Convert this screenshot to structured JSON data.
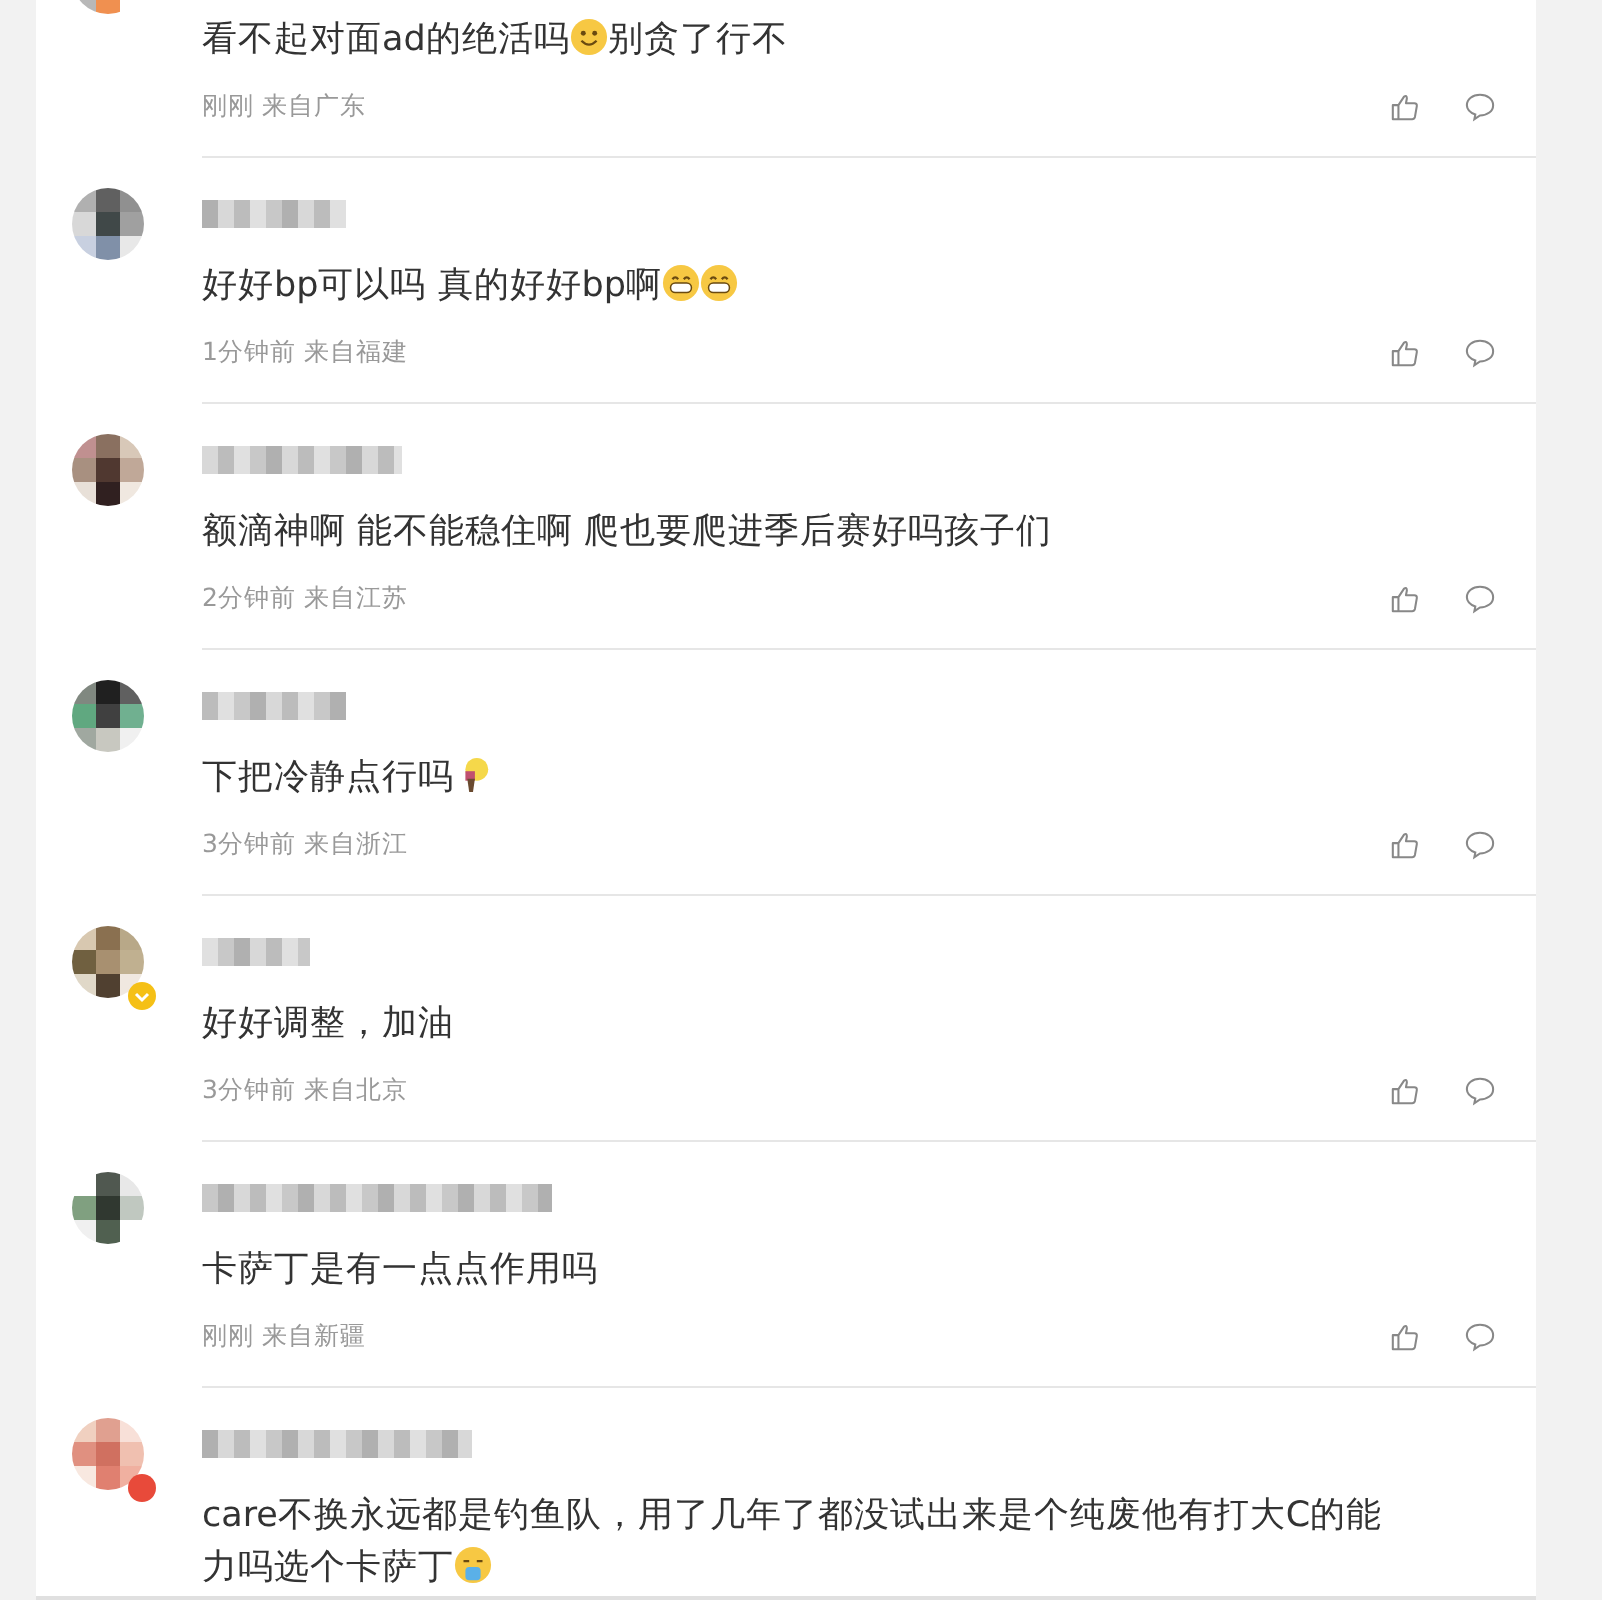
{
  "comments": [
    {
      "verified": false,
      "alert": false,
      "segments": [
        {
          "kind": "text",
          "text": "看不起对面ad的绝活吗"
        },
        {
          "kind": "smile"
        },
        {
          "kind": "text",
          "text": "别贪了行不"
        }
      ],
      "time": "刚刚",
      "location": "来自广东"
    },
    {
      "verified": false,
      "alert": false,
      "segments": [
        {
          "kind": "text",
          "text": "好好bp可以吗 真的好好bp啊"
        },
        {
          "kind": "grin"
        },
        {
          "kind": "grin"
        }
      ],
      "time": "1分钟前",
      "location": "来自福建"
    },
    {
      "verified": false,
      "alert": false,
      "segments": [
        {
          "kind": "text",
          "text": "额滴神啊 能不能稳住啊 爬也要爬进季后赛好吗孩子们"
        }
      ],
      "time": "2分钟前",
      "location": "来自江苏"
    },
    {
      "verified": false,
      "alert": false,
      "segments": [
        {
          "kind": "text",
          "text": "下把冷静点行吗"
        },
        {
          "kind": "bulb"
        }
      ],
      "time": "3分钟前",
      "location": "来自浙江"
    },
    {
      "verified": true,
      "alert": false,
      "segments": [
        {
          "kind": "text",
          "text": "好好调整，加油"
        }
      ],
      "time": "3分钟前",
      "location": "来自北京"
    },
    {
      "verified": false,
      "alert": false,
      "segments": [
        {
          "kind": "text",
          "text": "卡萨丁是有一点点作用吗"
        }
      ],
      "time": "刚刚",
      "location": "来自新疆"
    },
    {
      "verified": false,
      "alert": true,
      "segments": [
        {
          "kind": "text",
          "text": "care不换永远都是钓鱼队，用了几年了都没试出来是个纯废他有打大C的能"
        },
        {
          "kind": "break"
        },
        {
          "kind": "text",
          "text": "力吗选个卡萨丁"
        },
        {
          "kind": "puke"
        }
      ]
    }
  ]
}
